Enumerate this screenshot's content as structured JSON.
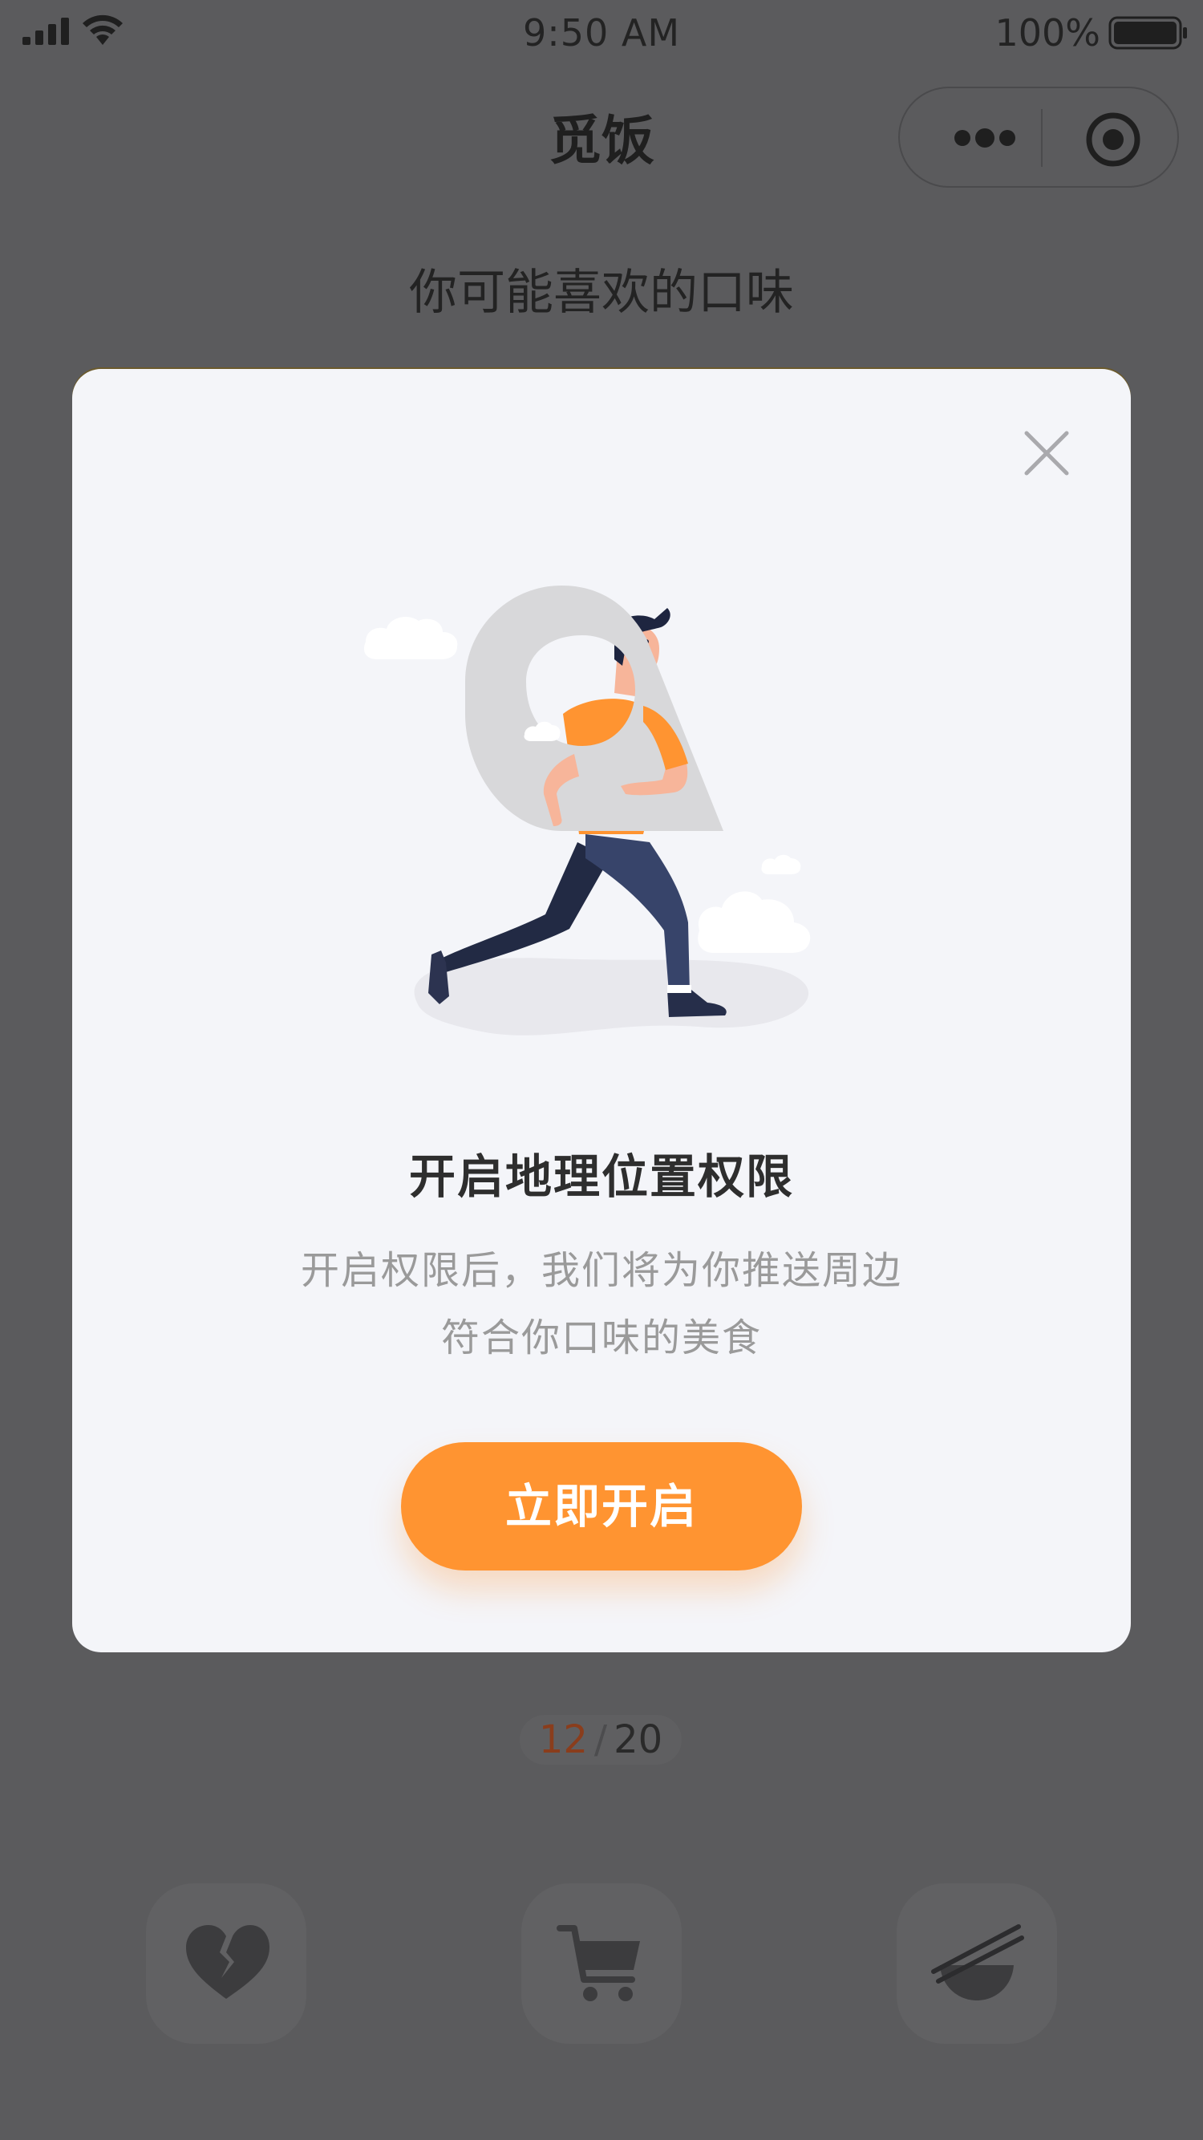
{
  "status_bar": {
    "time": "9:50 AM",
    "battery": "100%",
    "icons": [
      "signal-icon",
      "wifi-icon",
      "battery-icon"
    ]
  },
  "nav": {
    "title": "觅饭",
    "capsule_icons": [
      "more-icon",
      "close-miniprogram-icon"
    ]
  },
  "page": {
    "section_title": "你可能喜欢的口味",
    "counter": {
      "current": "12",
      "separator": "/",
      "total": "20"
    },
    "actions": [
      {
        "icon": "broken-heart-icon"
      },
      {
        "icon": "cart-icon"
      },
      {
        "icon": "bowl-chopsticks-icon"
      }
    ]
  },
  "modal": {
    "close_icon": "close-icon",
    "illustration": "man-carrying-location-pin-illustration",
    "heading": "开启地理位置权限",
    "description_line1": "开启权限后，我们将为你推送周边",
    "description_line2": "符合你口味的美食",
    "button_label": "立即开启"
  },
  "colors": {
    "overlay_background": "#5b5b5d",
    "modal_background": "#f4f5f9",
    "accent": "#ff9431",
    "counter_current": "#8a3d1c"
  }
}
